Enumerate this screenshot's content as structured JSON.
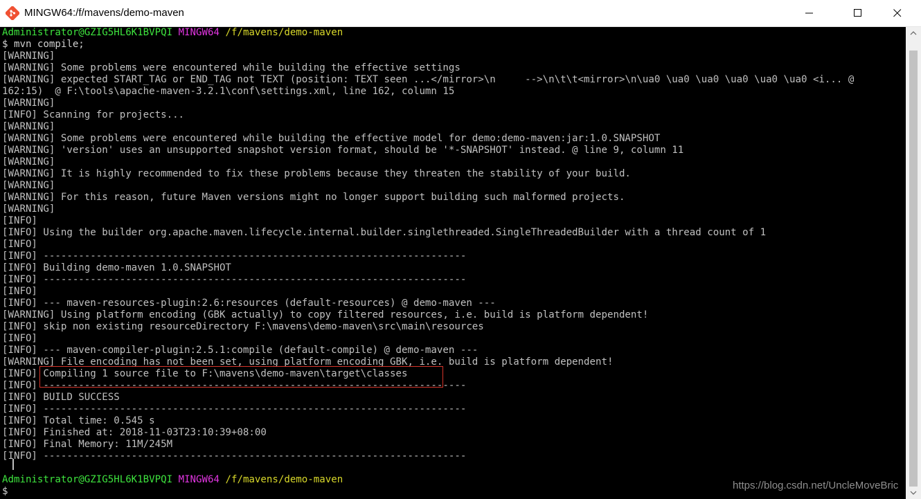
{
  "window": {
    "title": "MINGW64:/f/mavens/demo-maven",
    "icon": "git-bash-icon",
    "controls": [
      "minimize-icon",
      "maximize-icon",
      "close-icon"
    ]
  },
  "terminal": {
    "prompt_top": {
      "user_host": "Administrator@GZIG5HL6K1BVPQI",
      "shell": "MINGW64",
      "path": "/f/mavens/demo-maven"
    },
    "command": "$ mvn compile;",
    "output": [
      "[WARNING]",
      "[WARNING] Some problems were encountered while building the effective settings",
      "[WARNING] expected START_TAG or END_TAG not TEXT (position: TEXT seen ...</mirror>\\n     -->\\n\\t\\t<mirror>\\n\\ua0 \\ua0 \\ua0 \\ua0 \\ua0 \\ua0 <i... @",
      "162:15)  @ F:\\tools\\apache-maven-3.2.1\\conf\\settings.xml, line 162, column 15",
      "[WARNING]",
      "[INFO] Scanning for projects...",
      "[WARNING]",
      "[WARNING] Some problems were encountered while building the effective model for demo:demo-maven:jar:1.0.SNAPSHOT",
      "[WARNING] 'version' uses an unsupported snapshot version format, should be '*-SNAPSHOT' instead. @ line 9, column 11",
      "[WARNING]",
      "[WARNING] It is highly recommended to fix these problems because they threaten the stability of your build.",
      "[WARNING]",
      "[WARNING] For this reason, future Maven versions might no longer support building such malformed projects.",
      "[WARNING]",
      "[INFO]",
      "[INFO] Using the builder org.apache.maven.lifecycle.internal.builder.singlethreaded.SingleThreadedBuilder with a thread count of 1",
      "[INFO]",
      "[INFO] ------------------------------------------------------------------------",
      "[INFO] Building demo-maven 1.0.SNAPSHOT",
      "[INFO] ------------------------------------------------------------------------",
      "[INFO]",
      "[INFO] --- maven-resources-plugin:2.6:resources (default-resources) @ demo-maven ---",
      "[WARNING] Using platform encoding (GBK actually) to copy filtered resources, i.e. build is platform dependent!",
      "[INFO] skip non existing resourceDirectory F:\\mavens\\demo-maven\\src\\main\\resources",
      "[INFO]",
      "[INFO] --- maven-compiler-plugin:2.5.1:compile (default-compile) @ demo-maven ---",
      "[WARNING] File encoding has not been set, using platform encoding GBK, i.e. build is platform dependent!",
      "[INFO] Compiling 1 source file to F:\\mavens\\demo-maven\\target\\classes",
      "[INFO] ------------------------------------------------------------------------",
      "[INFO] BUILD SUCCESS",
      "[INFO] ------------------------------------------------------------------------",
      "[INFO] Total time: 0.545 s",
      "[INFO] Finished at: 2018-11-03T23:10:39+08:00",
      "[INFO] Final Memory: 11M/245M",
      "[INFO] ------------------------------------------------------------------------"
    ],
    "prompt_bottom": {
      "user_host": "Administrator@GZIG5HL6K1BVPQI",
      "shell": "MINGW64",
      "path": "/f/mavens/demo-maven"
    },
    "input_prompt": "$"
  },
  "watermark": "https://blog.csdn.net/UncleMoveBric",
  "colors": {
    "background": "#000000",
    "text": "#c0c0c0",
    "user_host": "#3ee43e",
    "shell": "#e035e0",
    "path": "#d8d82a",
    "highlight_border": "#d6342a"
  }
}
